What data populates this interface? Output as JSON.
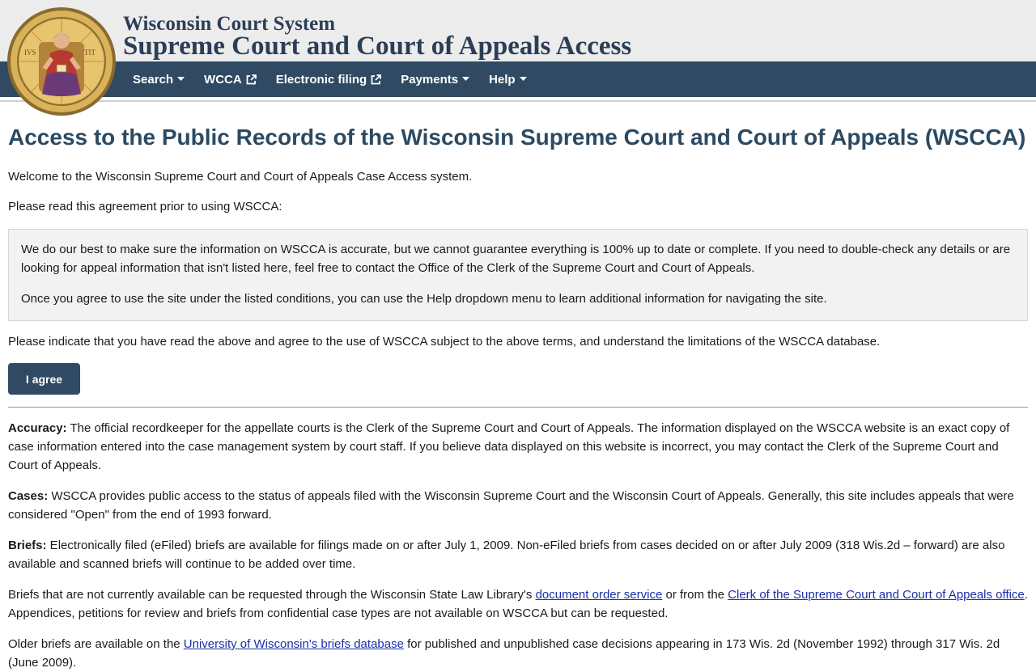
{
  "header": {
    "subtitle": "Wisconsin Court System",
    "title": "Supreme Court and Court of Appeals Access"
  },
  "nav": {
    "items": [
      {
        "label": "Search",
        "icon": "caret-down-icon"
      },
      {
        "label": "WCCA",
        "icon": "external-link-icon"
      },
      {
        "label": "Electronic filing",
        "icon": "external-link-icon"
      },
      {
        "label": "Payments",
        "icon": "caret-down-icon"
      },
      {
        "label": "Help",
        "icon": "caret-down-icon"
      }
    ]
  },
  "page": {
    "heading": "Access to the Public Records of the Wisconsin Supreme Court and Court of Appeals (WSCCA)",
    "welcome": "Welcome to the Wisconsin Supreme Court and Court of Appeals Case Access system.",
    "read_prompt": "Please read this agreement prior to using WSCCA:",
    "notice": {
      "p1": "We do our best to make sure the information on WSCCA is accurate, but we cannot guarantee everything is 100% up to date or complete. If you need to double-check any details or are looking for appeal information that isn't listed here, feel free to contact the Office of the Clerk of the Supreme Court and Court of Appeals.",
      "p2": "Once you agree to use the site under the listed conditions, you can use the Help dropdown menu to learn additional information for navigating the site."
    },
    "indicate": "Please indicate that you have read the above and agree to the use of WSCCA subject to the above terms, and understand the limitations of the WSCCA database.",
    "agree_label": "I agree"
  },
  "info": {
    "accuracy_label": "Accuracy:",
    "accuracy_text": " The official recordkeeper for the appellate courts is the Clerk of the Supreme Court and Court of Appeals. The information displayed on the WSCCA website is an exact copy of case information entered into the case management system by court staff. If you believe data displayed on this website is incorrect, you may contact the Clerk of the Supreme Court and Court of Appeals.",
    "cases_label": "Cases:",
    "cases_text": " WSCCA provides public access to the status of appeals filed with the Wisconsin Supreme Court and the Wisconsin Court of Appeals. Generally, this site includes appeals that were considered \"Open\" from the end of 1993 forward.",
    "briefs_label": "Briefs:",
    "briefs_text": " Electronically filed (eFiled) briefs are available for filings made on or after July 1, 2009. Non-eFiled briefs from cases decided on or after July 2009 (318 Wis.2d – forward) are also available and scanned briefs will continue to be added over time.",
    "request_pre": "Briefs that are not currently available can be requested through the Wisconsin State Law Library's ",
    "request_link1": "document order service",
    "request_mid": " or from the ",
    "request_link2": "Clerk of the Supreme Court and Court of Appeals office",
    "request_post": ". Appendices, petitions for review and briefs from confidential case types are not available on WSCCA but can be requested.",
    "older_pre": "Older briefs are available on the ",
    "older_link": "University of Wisconsin's briefs database",
    "older_post": " for published and unpublished case decisions appearing in 173 Wis. 2d (November 1992) through 317 Wis. 2d (June 2009)."
  },
  "colors": {
    "brand_navy": "#2f4a62",
    "header_bg": "#ececec",
    "link": "#1a2fa8"
  }
}
